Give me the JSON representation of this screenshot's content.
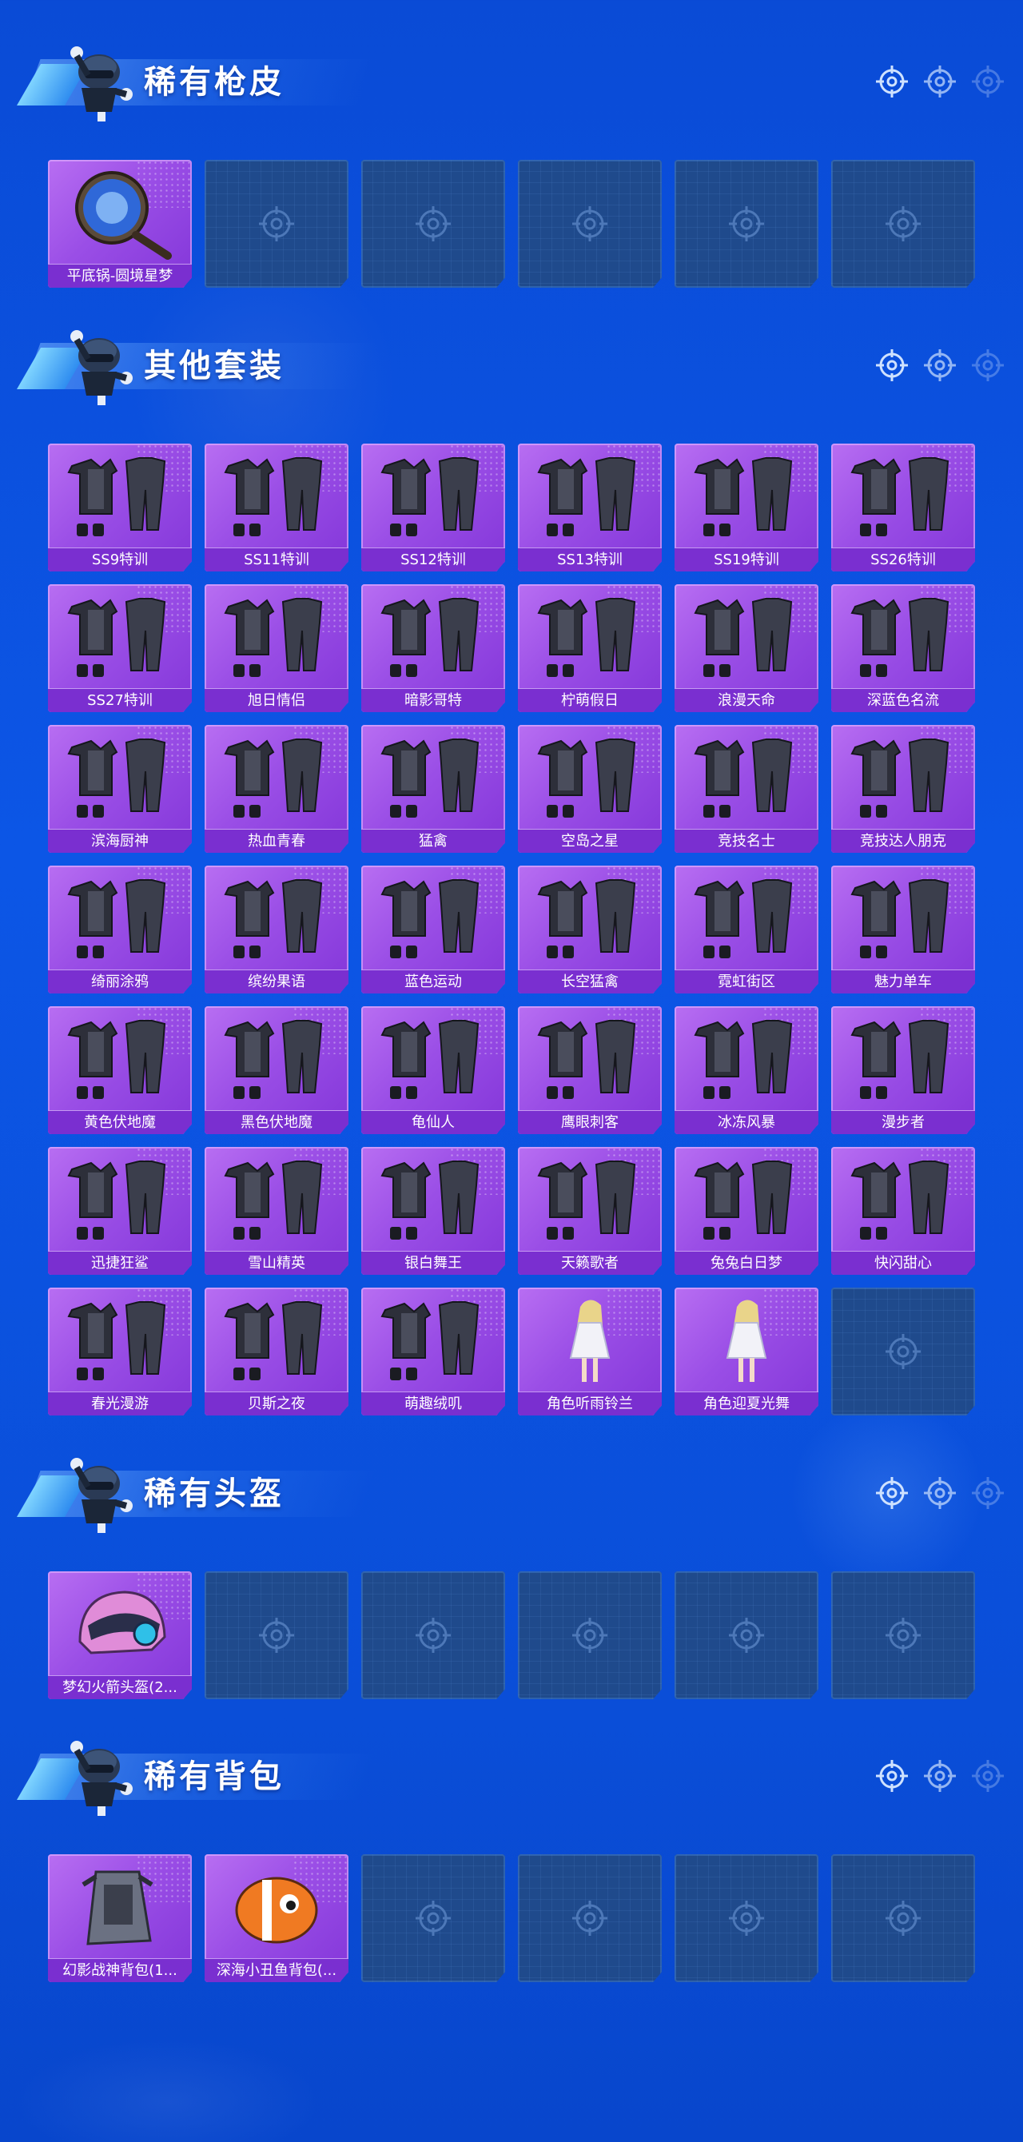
{
  "sections": [
    {
      "title": "稀有枪皮",
      "items": [
        {
          "label": "平底锅-圆境星梦",
          "art": "pan"
        }
      ],
      "empty_slots": 5
    },
    {
      "title": "其他套装",
      "items": [
        {
          "label": "SS9特训",
          "art": "outfit"
        },
        {
          "label": "SS11特训",
          "art": "outfit"
        },
        {
          "label": "SS12特训",
          "art": "outfit"
        },
        {
          "label": "SS13特训",
          "art": "outfit"
        },
        {
          "label": "SS19特训",
          "art": "outfit"
        },
        {
          "label": "SS26特训",
          "art": "outfit"
        },
        {
          "label": "SS27特训",
          "art": "outfit"
        },
        {
          "label": "旭日情侣",
          "art": "outfit"
        },
        {
          "label": "暗影哥特",
          "art": "outfit"
        },
        {
          "label": "柠萌假日",
          "art": "outfit"
        },
        {
          "label": "浪漫天命",
          "art": "outfit"
        },
        {
          "label": "深蓝色名流",
          "art": "outfit"
        },
        {
          "label": "滨海厨神",
          "art": "outfit"
        },
        {
          "label": "热血青春",
          "art": "outfit"
        },
        {
          "label": "猛禽",
          "art": "outfit"
        },
        {
          "label": "空岛之星",
          "art": "outfit"
        },
        {
          "label": "竞技名士",
          "art": "outfit"
        },
        {
          "label": "竞技达人朋克",
          "art": "outfit"
        },
        {
          "label": "绮丽涂鸦",
          "art": "outfit"
        },
        {
          "label": "缤纷果语",
          "art": "outfit"
        },
        {
          "label": "蓝色运动",
          "art": "outfit"
        },
        {
          "label": "长空猛禽",
          "art": "outfit"
        },
        {
          "label": "霓虹街区",
          "art": "outfit"
        },
        {
          "label": "魅力单车",
          "art": "outfit"
        },
        {
          "label": "黄色伏地魔",
          "art": "outfit"
        },
        {
          "label": "黑色伏地魔",
          "art": "outfit"
        },
        {
          "label": "龟仙人",
          "art": "outfit"
        },
        {
          "label": "鹰眼刺客",
          "art": "outfit"
        },
        {
          "label": "冰冻风暴",
          "art": "outfit"
        },
        {
          "label": "漫步者",
          "art": "outfit"
        },
        {
          "label": "迅捷狂鲨",
          "art": "outfit"
        },
        {
          "label": "雪山精英",
          "art": "outfit"
        },
        {
          "label": "银白舞王",
          "art": "outfit"
        },
        {
          "label": "天籁歌者",
          "art": "outfit"
        },
        {
          "label": "兔兔白日梦",
          "art": "outfit"
        },
        {
          "label": "快闪甜心",
          "art": "outfit"
        },
        {
          "label": "春光漫游",
          "art": "outfit"
        },
        {
          "label": "贝斯之夜",
          "art": "outfit"
        },
        {
          "label": "萌趣绒叽",
          "art": "outfit"
        },
        {
          "label": "角色听雨铃兰",
          "art": "figure"
        },
        {
          "label": "角色迎夏光舞",
          "art": "figure"
        }
      ],
      "empty_slots": 1
    },
    {
      "title": "稀有头盔",
      "items": [
        {
          "label": "梦幻火箭头盔(2...",
          "art": "helmet"
        }
      ],
      "empty_slots": 5
    },
    {
      "title": "稀有背包",
      "items": [
        {
          "label": "幻影战神背包(1...",
          "art": "backpack"
        },
        {
          "label": "深海小丑鱼背包(...",
          "art": "clownfish"
        }
      ],
      "empty_slots": 4
    }
  ],
  "icons": {
    "empty_slot": "crosshair-icon",
    "header_mascot": "helmet-mascot-icon",
    "header_deco": "crosshair-icon"
  },
  "colors": {
    "background": "#0a4bd6",
    "card_purple": "#9a4ee6",
    "label_bar": "#7a2fd0",
    "empty_slot": "#1f4a8c"
  }
}
